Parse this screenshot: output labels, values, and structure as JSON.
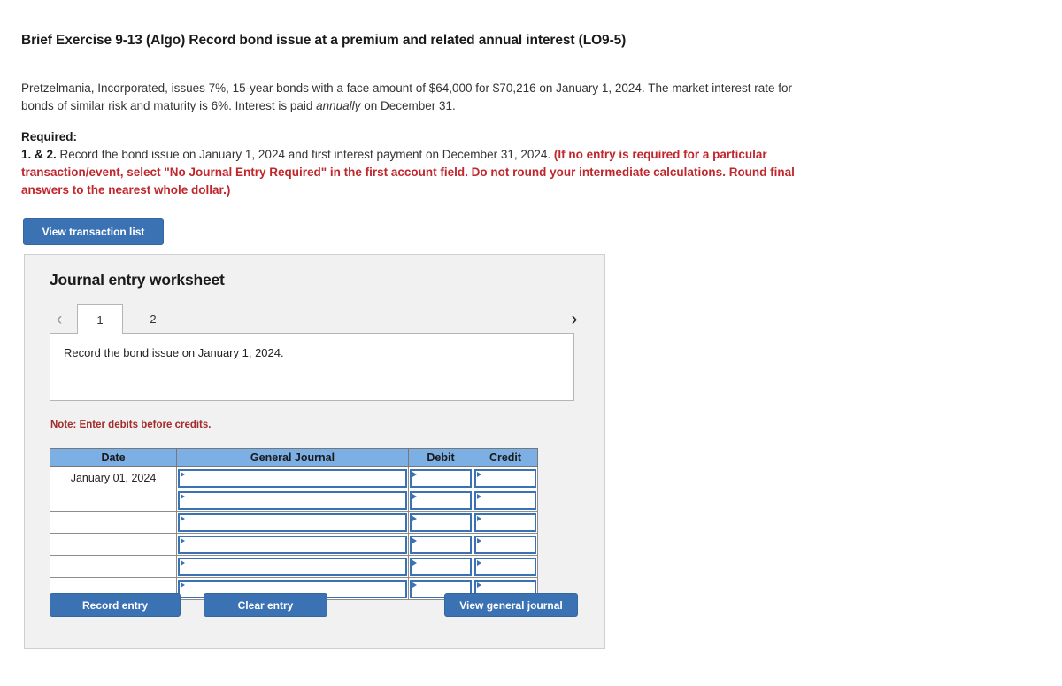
{
  "question": {
    "title": "Brief Exercise 9-13 (Algo) Record bond issue at a premium and related annual interest (LO9-5)",
    "body_line1": "Pretzelmania, Incorporated, issues 7%, 15-year bonds with a face amount of $64,000 for $70,216 on January 1, 2024. The market",
    "body_line2_pre": "interest rate for bonds of similar risk and maturity is 6%. Interest is paid ",
    "body_line2_italic": "annually",
    "body_line2_post": " on December 31.",
    "required_label": "Required:",
    "required_number": "1. & 2.",
    "required_text": " Record the bond issue on January 1, 2024 and first interest payment on December 31, 2024. ",
    "required_red": "(If no entry is required for a particular transaction/event, select \"No Journal Entry Required\" in the first account field. Do not round your intermediate calculations. Round final answers to the nearest whole dollar.)"
  },
  "toolbar": {
    "view_transaction_list": "View transaction list"
  },
  "worksheet": {
    "title": "Journal entry worksheet",
    "prev_icon": "‹",
    "next_icon": "›",
    "tabs": [
      {
        "label": "1",
        "active": true
      },
      {
        "label": "2",
        "active": false
      }
    ],
    "instruction": "Record the bond issue on January 1, 2024.",
    "note": "Note: Enter debits before credits.",
    "table": {
      "columns": [
        "Date",
        "General Journal",
        "Debit",
        "Credit"
      ],
      "rows": [
        {
          "date": "January 01, 2024",
          "general_journal": "",
          "debit": "",
          "credit": ""
        },
        {
          "date": "",
          "general_journal": "",
          "debit": "",
          "credit": ""
        },
        {
          "date": "",
          "general_journal": "",
          "debit": "",
          "credit": ""
        },
        {
          "date": "",
          "general_journal": "",
          "debit": "",
          "credit": ""
        },
        {
          "date": "",
          "general_journal": "",
          "debit": "",
          "credit": ""
        },
        {
          "date": "",
          "general_journal": "",
          "debit": "",
          "credit": ""
        }
      ]
    },
    "buttons": {
      "record_entry": "Record entry",
      "clear_entry": "Clear entry",
      "view_general_journal": "View general journal"
    }
  },
  "colors": {
    "button_blue": "#3a72b4",
    "header_blue": "#7cafe3",
    "alert_red": "#c0272d",
    "note_red": "#a32b2b",
    "panel_bg": "#f1f1f1"
  }
}
